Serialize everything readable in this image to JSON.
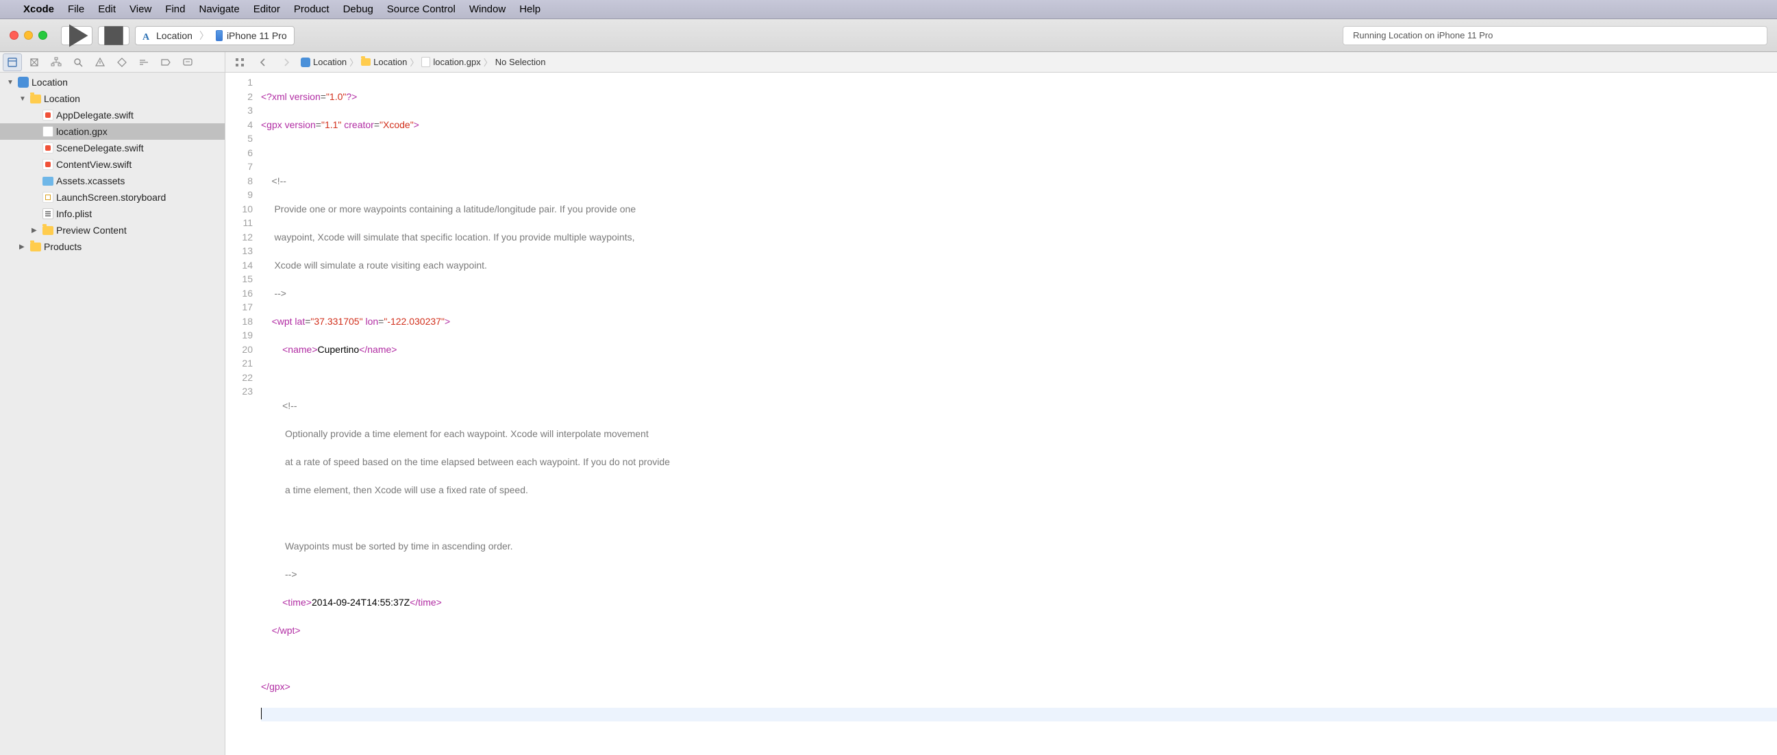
{
  "menubar": {
    "app": "Xcode",
    "items": [
      "File",
      "Edit",
      "View",
      "Find",
      "Navigate",
      "Editor",
      "Product",
      "Debug",
      "Source Control",
      "Window",
      "Help"
    ]
  },
  "toolbar": {
    "scheme_project": "Location",
    "scheme_device": "iPhone 11 Pro",
    "activity": "Running Location on iPhone 11 Pro"
  },
  "jumpbar": {
    "p1": "Location",
    "p2": "Location",
    "p3": "location.gpx",
    "p4": "No Selection"
  },
  "navigator": {
    "root": "Location",
    "folder": "Location",
    "files": {
      "0": "AppDelegate.swift",
      "1": "location.gpx",
      "2": "SceneDelegate.swift",
      "3": "ContentView.swift",
      "4": "Assets.xcassets",
      "5": "LaunchScreen.storyboard",
      "6": "Info.plist",
      "7": "Preview Content"
    },
    "products": "Products"
  },
  "editor": {
    "line_count": 23,
    "lines": {
      "l1": {
        "raw": "<?xml version=\"1.0\"?>"
      },
      "l2": {
        "raw": "<gpx version=\"1.1\" creator=\"Xcode\">"
      },
      "l3": {
        "raw": ""
      },
      "l4": {
        "raw": "    <!--"
      },
      "l5": {
        "raw": "     Provide one or more waypoints containing a latitude/longitude pair. If you provide one"
      },
      "l6": {
        "raw": "     waypoint, Xcode will simulate that specific location. If you provide multiple waypoints,"
      },
      "l7": {
        "raw": "     Xcode will simulate a route visiting each waypoint."
      },
      "l8": {
        "raw": "     -->"
      },
      "l9": {
        "raw": "    <wpt lat=\"37.331705\" lon=\"-122.030237\">"
      },
      "l10": {
        "raw": "        <name>Cupertino</name>"
      },
      "l11": {
        "raw": ""
      },
      "l12": {
        "raw": "        <!--"
      },
      "l13": {
        "raw": "         Optionally provide a time element for each waypoint. Xcode will interpolate movement"
      },
      "l14": {
        "raw": "         at a rate of speed based on the time elapsed between each waypoint. If you do not provide"
      },
      "l15": {
        "raw": "         a time element, then Xcode will use a fixed rate of speed."
      },
      "l16": {
        "raw": ""
      },
      "l17": {
        "raw": "         Waypoints must be sorted by time in ascending order."
      },
      "l18": {
        "raw": "         -->"
      },
      "l19": {
        "raw": "        <time>2014-09-24T14:55:37Z</time>"
      },
      "l20": {
        "raw": "    </wpt>"
      },
      "l21": {
        "raw": ""
      },
      "l22": {
        "raw": "</gpx>"
      },
      "l23": {
        "raw": ""
      }
    },
    "syntax": {
      "name_value": "Cupertino",
      "time_value": "2014-09-24T14:55:37Z",
      "wpt_lat": "37.331705",
      "wpt_lon": "-122.030237",
      "gpx_version": "1.1",
      "gpx_creator": "Xcode"
    }
  }
}
